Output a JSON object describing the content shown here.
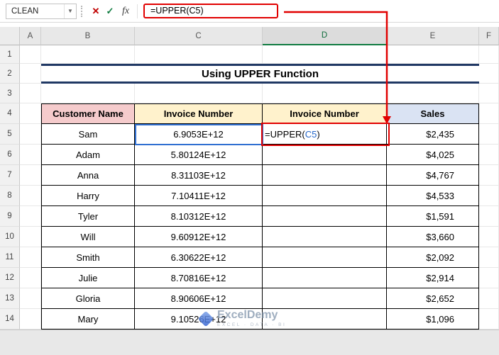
{
  "formula_bar": {
    "name_box": "CLEAN",
    "fx_label": "fx",
    "formula": "=UPPER(C5)"
  },
  "columns": [
    "A",
    "B",
    "C",
    "D",
    "E",
    "F"
  ],
  "row_numbers": [
    "1",
    "2",
    "3",
    "4",
    "5",
    "6",
    "7",
    "8",
    "9",
    "10",
    "11",
    "12",
    "13",
    "14"
  ],
  "title": "Using UPPER Function",
  "table": {
    "headers": {
      "customer": "Customer Name",
      "invoice_c": "Invoice Number",
      "invoice_d": "Invoice Number",
      "sales": "Sales"
    },
    "rows": [
      {
        "name": "Sam",
        "invoice": "6.9053E+12",
        "sales": "$2,435"
      },
      {
        "name": "Adam",
        "invoice": "5.80124E+12",
        "sales": "$4,025"
      },
      {
        "name": "Anna",
        "invoice": "8.31103E+12",
        "sales": "$4,767"
      },
      {
        "name": "Harry",
        "invoice": "7.10411E+12",
        "sales": "$4,533"
      },
      {
        "name": "Tyler",
        "invoice": "8.10312E+12",
        "sales": "$1,591"
      },
      {
        "name": "Will",
        "invoice": "9.60912E+12",
        "sales": "$3,660"
      },
      {
        "name": "Smith",
        "invoice": "6.30622E+12",
        "sales": "$2,092"
      },
      {
        "name": "Julie",
        "invoice": "8.70816E+12",
        "sales": "$2,914"
      },
      {
        "name": "Gloria",
        "invoice": "8.90606E+12",
        "sales": "$2,652"
      },
      {
        "name": "Mary",
        "invoice": "9.10526E+12",
        "sales": "$1,096"
      }
    ]
  },
  "active_cell": {
    "formula_pre": "=UPPER(",
    "formula_ref": "C5",
    "formula_post": ")"
  },
  "watermark": {
    "name": "ExcelDemy",
    "tagline": "EXCEL · DATA · BI"
  },
  "colors": {
    "accent_green": "#107C41",
    "annotation_red": "#E10000",
    "reference_blue": "#2F6FD1",
    "title_navy": "#203864",
    "header_pink": "#F5CBCC",
    "header_yellow": "#FFF2CC",
    "header_blue": "#DAE3F3"
  }
}
